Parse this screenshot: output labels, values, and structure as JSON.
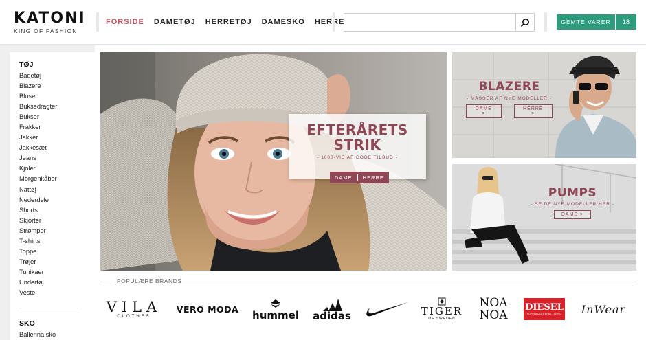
{
  "header": {
    "logo_main": "KATONI",
    "logo_sub": "KING OF FASHION",
    "nav": [
      {
        "label": "FORSIDE",
        "active": true
      },
      {
        "label": "DAMETØJ",
        "active": false
      },
      {
        "label": "HERRETØJ",
        "active": false
      },
      {
        "label": "DAMESKO",
        "active": false
      },
      {
        "label": "HERRESKO",
        "active": false
      }
    ],
    "search": {
      "value": "",
      "placeholder": "",
      "icon": "search-icon"
    },
    "saved_label": "GEMTE VARER",
    "saved_count": "18",
    "accent_color": "#2e9b7c",
    "active_color": "#c8505e"
  },
  "sidebar": {
    "section1": {
      "heading": "TØJ",
      "items": [
        "Badetøj",
        "Blazere",
        "Bluser",
        "Buksedragter",
        "Bukser",
        "Frakker",
        "Jakker",
        "Jakkesæt",
        "Jeans",
        "Kjoler",
        "Morgenkåber",
        "Nattøj",
        "Nederdele",
        "Shorts",
        "Skjorter",
        "Strømper",
        "T-shirts",
        "Toppe",
        "Trøjer",
        "Tunikaer",
        "Undertøj",
        "Veste"
      ]
    },
    "section2": {
      "heading": "SKO",
      "items": [
        "Ballerina sko"
      ]
    }
  },
  "hero": {
    "title_line1": "EFTERÅRETS",
    "title_line2": "STRIK",
    "subtitle": "- 1000-VIS AF GODE TILBUD -",
    "button_dame": "DAME",
    "button_herre": "HERRE",
    "color": "#8f4756"
  },
  "promo_blazer": {
    "title": "BLAZERE",
    "subtitle": "- MASSER AF NYE MODELLER -",
    "button_dame": "DAME >",
    "button_herre": "HERRE >"
  },
  "promo_pumps": {
    "title": "PUMPS",
    "subtitle": "- SE DE NYE MODELLER HER -",
    "button_dame": "DAME >"
  },
  "brands": {
    "heading": "POPULÆRE BRANDS",
    "items": [
      {
        "name": "VILA",
        "sub": "CLOTHES"
      },
      {
        "name": "VERO MODA"
      },
      {
        "name": "hummel"
      },
      {
        "name": "adidas"
      },
      {
        "name": "nike-swoosh"
      },
      {
        "name": "TIGER",
        "sub": "OF SWEDEN"
      },
      {
        "name": "NOA NOA"
      },
      {
        "name": "DIESEL",
        "sub": "FOR SUCCESSFUL LIVING"
      },
      {
        "name": "InWear"
      }
    ]
  }
}
